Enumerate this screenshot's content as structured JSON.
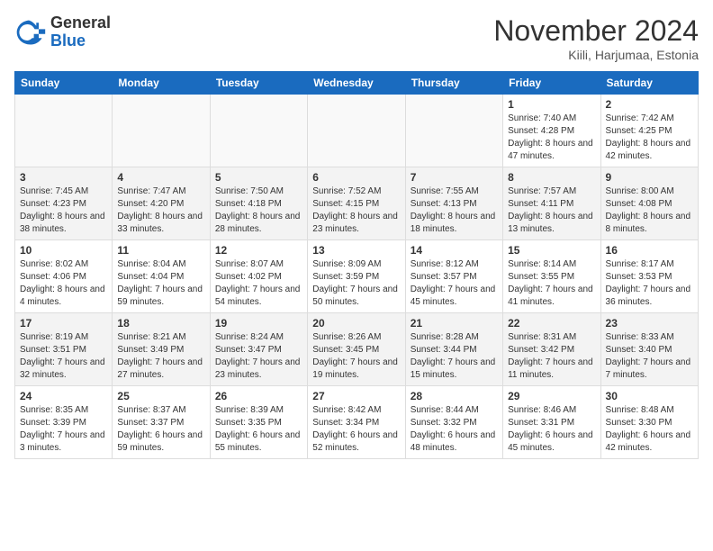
{
  "header": {
    "logo_general": "General",
    "logo_blue": "Blue",
    "month_title": "November 2024",
    "location": "Kiili, Harjumaa, Estonia"
  },
  "days_of_week": [
    "Sunday",
    "Monday",
    "Tuesday",
    "Wednesday",
    "Thursday",
    "Friday",
    "Saturday"
  ],
  "weeks": [
    [
      {
        "day": "",
        "info": ""
      },
      {
        "day": "",
        "info": ""
      },
      {
        "day": "",
        "info": ""
      },
      {
        "day": "",
        "info": ""
      },
      {
        "day": "",
        "info": ""
      },
      {
        "day": "1",
        "info": "Sunrise: 7:40 AM\nSunset: 4:28 PM\nDaylight: 8 hours and 47 minutes."
      },
      {
        "day": "2",
        "info": "Sunrise: 7:42 AM\nSunset: 4:25 PM\nDaylight: 8 hours and 42 minutes."
      }
    ],
    [
      {
        "day": "3",
        "info": "Sunrise: 7:45 AM\nSunset: 4:23 PM\nDaylight: 8 hours and 38 minutes."
      },
      {
        "day": "4",
        "info": "Sunrise: 7:47 AM\nSunset: 4:20 PM\nDaylight: 8 hours and 33 minutes."
      },
      {
        "day": "5",
        "info": "Sunrise: 7:50 AM\nSunset: 4:18 PM\nDaylight: 8 hours and 28 minutes."
      },
      {
        "day": "6",
        "info": "Sunrise: 7:52 AM\nSunset: 4:15 PM\nDaylight: 8 hours and 23 minutes."
      },
      {
        "day": "7",
        "info": "Sunrise: 7:55 AM\nSunset: 4:13 PM\nDaylight: 8 hours and 18 minutes."
      },
      {
        "day": "8",
        "info": "Sunrise: 7:57 AM\nSunset: 4:11 PM\nDaylight: 8 hours and 13 minutes."
      },
      {
        "day": "9",
        "info": "Sunrise: 8:00 AM\nSunset: 4:08 PM\nDaylight: 8 hours and 8 minutes."
      }
    ],
    [
      {
        "day": "10",
        "info": "Sunrise: 8:02 AM\nSunset: 4:06 PM\nDaylight: 8 hours and 4 minutes."
      },
      {
        "day": "11",
        "info": "Sunrise: 8:04 AM\nSunset: 4:04 PM\nDaylight: 7 hours and 59 minutes."
      },
      {
        "day": "12",
        "info": "Sunrise: 8:07 AM\nSunset: 4:02 PM\nDaylight: 7 hours and 54 minutes."
      },
      {
        "day": "13",
        "info": "Sunrise: 8:09 AM\nSunset: 3:59 PM\nDaylight: 7 hours and 50 minutes."
      },
      {
        "day": "14",
        "info": "Sunrise: 8:12 AM\nSunset: 3:57 PM\nDaylight: 7 hours and 45 minutes."
      },
      {
        "day": "15",
        "info": "Sunrise: 8:14 AM\nSunset: 3:55 PM\nDaylight: 7 hours and 41 minutes."
      },
      {
        "day": "16",
        "info": "Sunrise: 8:17 AM\nSunset: 3:53 PM\nDaylight: 7 hours and 36 minutes."
      }
    ],
    [
      {
        "day": "17",
        "info": "Sunrise: 8:19 AM\nSunset: 3:51 PM\nDaylight: 7 hours and 32 minutes."
      },
      {
        "day": "18",
        "info": "Sunrise: 8:21 AM\nSunset: 3:49 PM\nDaylight: 7 hours and 27 minutes."
      },
      {
        "day": "19",
        "info": "Sunrise: 8:24 AM\nSunset: 3:47 PM\nDaylight: 7 hours and 23 minutes."
      },
      {
        "day": "20",
        "info": "Sunrise: 8:26 AM\nSunset: 3:45 PM\nDaylight: 7 hours and 19 minutes."
      },
      {
        "day": "21",
        "info": "Sunrise: 8:28 AM\nSunset: 3:44 PM\nDaylight: 7 hours and 15 minutes."
      },
      {
        "day": "22",
        "info": "Sunrise: 8:31 AM\nSunset: 3:42 PM\nDaylight: 7 hours and 11 minutes."
      },
      {
        "day": "23",
        "info": "Sunrise: 8:33 AM\nSunset: 3:40 PM\nDaylight: 7 hours and 7 minutes."
      }
    ],
    [
      {
        "day": "24",
        "info": "Sunrise: 8:35 AM\nSunset: 3:39 PM\nDaylight: 7 hours and 3 minutes."
      },
      {
        "day": "25",
        "info": "Sunrise: 8:37 AM\nSunset: 3:37 PM\nDaylight: 6 hours and 59 minutes."
      },
      {
        "day": "26",
        "info": "Sunrise: 8:39 AM\nSunset: 3:35 PM\nDaylight: 6 hours and 55 minutes."
      },
      {
        "day": "27",
        "info": "Sunrise: 8:42 AM\nSunset: 3:34 PM\nDaylight: 6 hours and 52 minutes."
      },
      {
        "day": "28",
        "info": "Sunrise: 8:44 AM\nSunset: 3:32 PM\nDaylight: 6 hours and 48 minutes."
      },
      {
        "day": "29",
        "info": "Sunrise: 8:46 AM\nSunset: 3:31 PM\nDaylight: 6 hours and 45 minutes."
      },
      {
        "day": "30",
        "info": "Sunrise: 8:48 AM\nSunset: 3:30 PM\nDaylight: 6 hours and 42 minutes."
      }
    ]
  ]
}
